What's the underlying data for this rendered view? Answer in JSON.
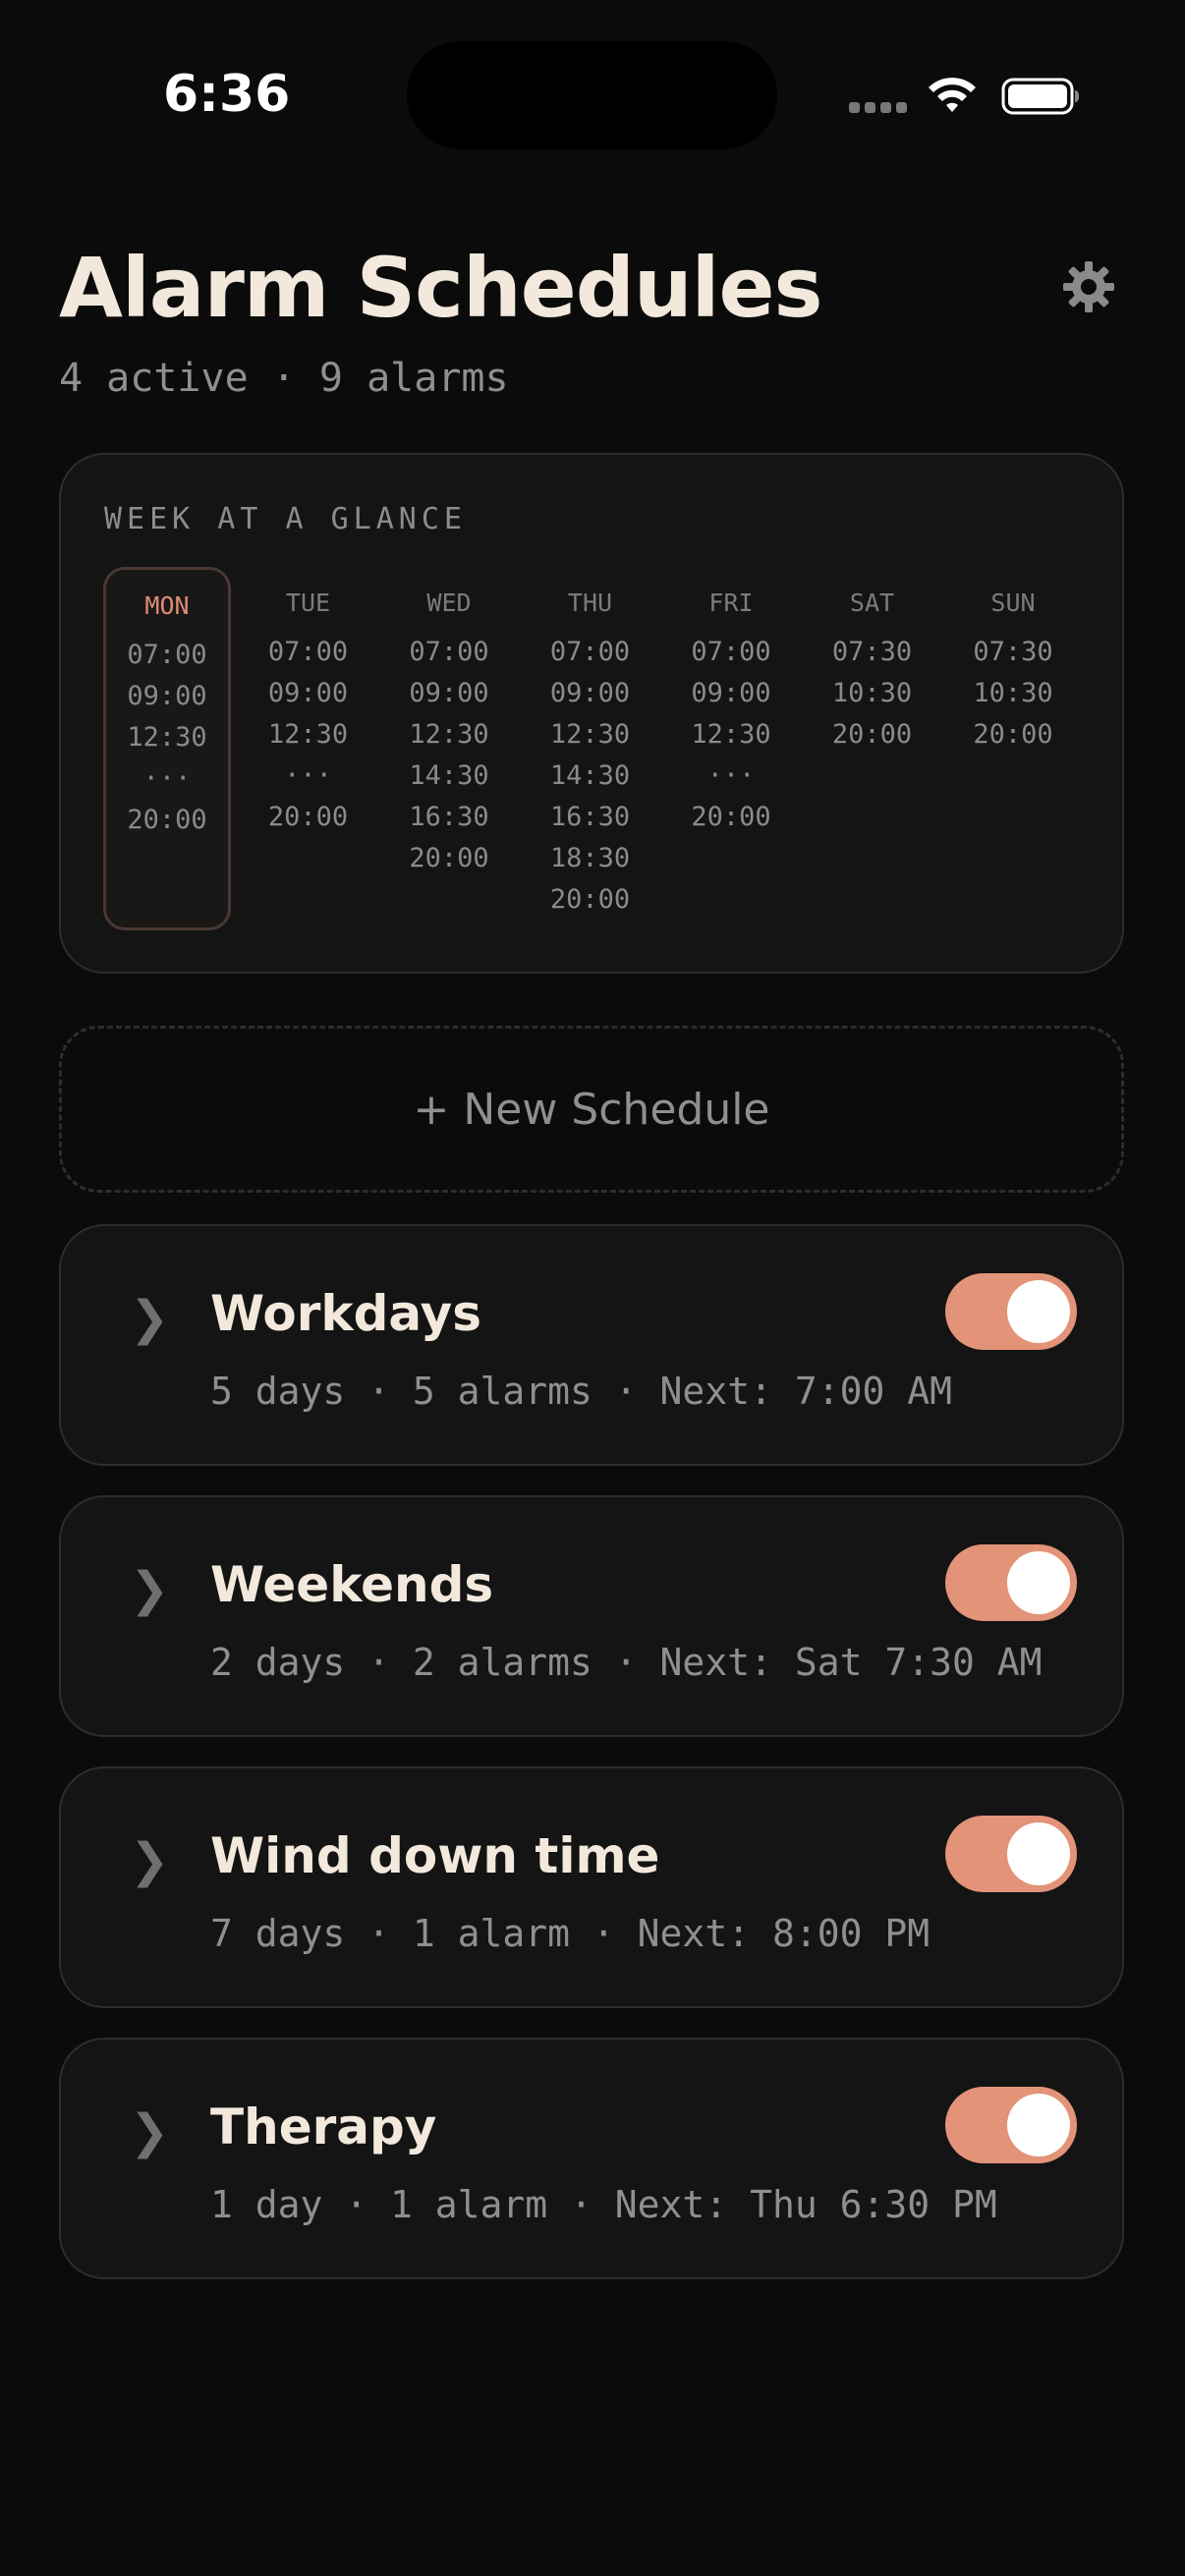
{
  "status_bar": {
    "time": "6:36"
  },
  "header": {
    "title": "Alarm Schedules",
    "subtitle": "4 active · 9 alarms",
    "settings_icon": "gear-icon"
  },
  "week": {
    "title": "WEEK AT A GLANCE",
    "days": [
      {
        "label": "MON",
        "selected": true,
        "times": [
          "07:00",
          "09:00",
          "12:30",
          "···",
          "20:00"
        ]
      },
      {
        "label": "TUE",
        "selected": false,
        "times": [
          "07:00",
          "09:00",
          "12:30",
          "···",
          "20:00"
        ]
      },
      {
        "label": "WED",
        "selected": false,
        "times": [
          "07:00",
          "09:00",
          "12:30",
          "14:30",
          "16:30",
          "20:00"
        ]
      },
      {
        "label": "THU",
        "selected": false,
        "times": [
          "07:00",
          "09:00",
          "12:30",
          "14:30",
          "16:30",
          "18:30",
          "20:00"
        ]
      },
      {
        "label": "FRI",
        "selected": false,
        "times": [
          "07:00",
          "09:00",
          "12:30",
          "···",
          "20:00"
        ]
      },
      {
        "label": "SAT",
        "selected": false,
        "times": [
          "07:30",
          "10:30",
          "20:00"
        ]
      },
      {
        "label": "SUN",
        "selected": false,
        "times": [
          "07:30",
          "10:30",
          "20:00"
        ]
      }
    ]
  },
  "new_schedule_label": "+ New Schedule",
  "schedules": [
    {
      "name": "Workdays",
      "meta": "5 days · 5 alarms · Next: 7:00 AM",
      "enabled": true
    },
    {
      "name": "Weekends",
      "meta": "2 days · 2 alarms · Next: Sat 7:30 AM",
      "enabled": true
    },
    {
      "name": "Wind down time",
      "meta": "7 days · 1 alarm · Next: 8:00 PM",
      "enabled": true
    },
    {
      "name": "Therapy",
      "meta": "1 day · 1 alarm · Next: Thu 6:30 PM",
      "enabled": true
    }
  ],
  "colors": {
    "background": "#0b0b0b",
    "card": "#141414",
    "accent": "#e29378",
    "title": "#f2e8dc",
    "muted": "#8f8f8f"
  }
}
